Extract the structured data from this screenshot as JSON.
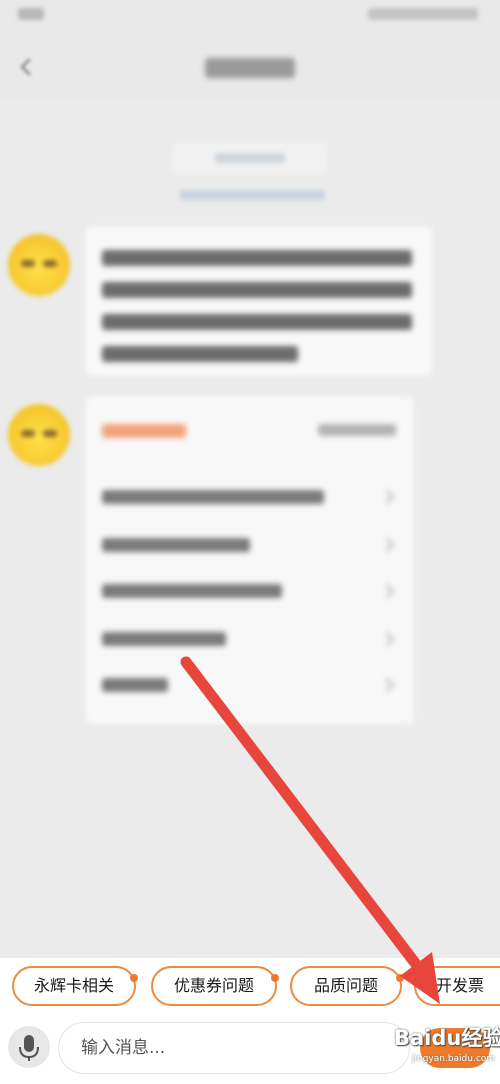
{
  "quick_replies": [
    {
      "label": "永辉卡相关"
    },
    {
      "label": "优惠券问题"
    },
    {
      "label": "品质问题"
    },
    {
      "label": "开发票"
    }
  ],
  "input": {
    "placeholder": "输入消息..."
  },
  "watermark": {
    "text": "Baidu经验",
    "sub": "jingyan.baidu.com"
  },
  "icons": {
    "mic": "microphone-icon",
    "back": "back-arrow-icon"
  },
  "colors": {
    "accent": "#f07a2a",
    "chip_border": "#ec8a3e",
    "arrow": "#e8453c"
  }
}
